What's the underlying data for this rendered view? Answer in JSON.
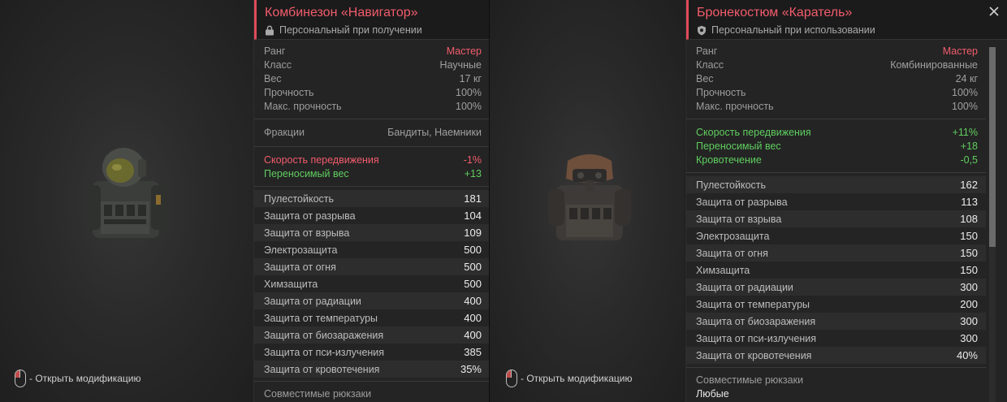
{
  "left": {
    "title": "Комбинезон «Навигатор»",
    "binding": "Персональный при получении",
    "binding_icon": "lock-icon",
    "base": [
      {
        "k": "Ранг",
        "v": "Мастер",
        "accent": true
      },
      {
        "k": "Класс",
        "v": "Научные"
      },
      {
        "k": "Вес",
        "v": "17 кг"
      },
      {
        "k": "Прочность",
        "v": "100%"
      },
      {
        "k": "Макс. прочность",
        "v": "100%"
      }
    ],
    "factions": {
      "k": "Фракции",
      "v": "Бандиты, Наемники"
    },
    "modifiers": [
      {
        "k": "Скорость передвижения",
        "v": "-1%",
        "tone": "red"
      },
      {
        "k": "Переносимый вес",
        "v": "+13",
        "tone": "green"
      }
    ],
    "stats": [
      {
        "k": "Пулестойкость",
        "v": "181"
      },
      {
        "k": "Защита от разрыва",
        "v": "104"
      },
      {
        "k": "Защита от взрыва",
        "v": "109"
      },
      {
        "k": "Электрозащита",
        "v": "500"
      },
      {
        "k": "Защита от огня",
        "v": "500"
      },
      {
        "k": "Химзащита",
        "v": "500"
      },
      {
        "k": "Защита от радиации",
        "v": "400"
      },
      {
        "k": "Защита от температуры",
        "v": "400"
      },
      {
        "k": "Защита от биозаражения",
        "v": "400"
      },
      {
        "k": "Защита от пси-излучения",
        "v": "385"
      },
      {
        "k": "Защита от кровотечения",
        "v": "35%"
      }
    ],
    "compat_label": "Совместимые рюкзаки",
    "hint": "- Открыть модификацию"
  },
  "right": {
    "title": "Бронекостюм «Каратель»",
    "binding": "Персональный при использовании",
    "binding_icon": "shield-icon",
    "base": [
      {
        "k": "Ранг",
        "v": "Мастер",
        "accent": true
      },
      {
        "k": "Класс",
        "v": "Комбинированные"
      },
      {
        "k": "Вес",
        "v": "24 кг"
      },
      {
        "k": "Прочность",
        "v": "100%"
      },
      {
        "k": "Макс. прочность",
        "v": "100%"
      }
    ],
    "modifiers": [
      {
        "k": "Скорость передвижения",
        "v": "+11%",
        "tone": "green"
      },
      {
        "k": "Переносимый вес",
        "v": "+18",
        "tone": "green"
      },
      {
        "k": "Кровотечение",
        "v": "-0,5",
        "tone": "green"
      }
    ],
    "stats": [
      {
        "k": "Пулестойкость",
        "v": "162"
      },
      {
        "k": "Защита от разрыва",
        "v": "113"
      },
      {
        "k": "Защита от взрыва",
        "v": "108"
      },
      {
        "k": "Электрозащита",
        "v": "150"
      },
      {
        "k": "Защита от огня",
        "v": "150"
      },
      {
        "k": "Химзащита",
        "v": "150"
      },
      {
        "k": "Защита от радиации",
        "v": "300"
      },
      {
        "k": "Защита от температуры",
        "v": "200"
      },
      {
        "k": "Защита от биозаражения",
        "v": "300"
      },
      {
        "k": "Защита от пси-излучения",
        "v": "300"
      },
      {
        "k": "Защита от кровотечения",
        "v": "40%"
      }
    ],
    "compat_label": "Совместимые рюкзаки",
    "compat_value": "Любые",
    "hint": "- Открыть модификацию"
  },
  "colors": {
    "accent": "#f25c6c",
    "positive": "#5fce5f"
  }
}
